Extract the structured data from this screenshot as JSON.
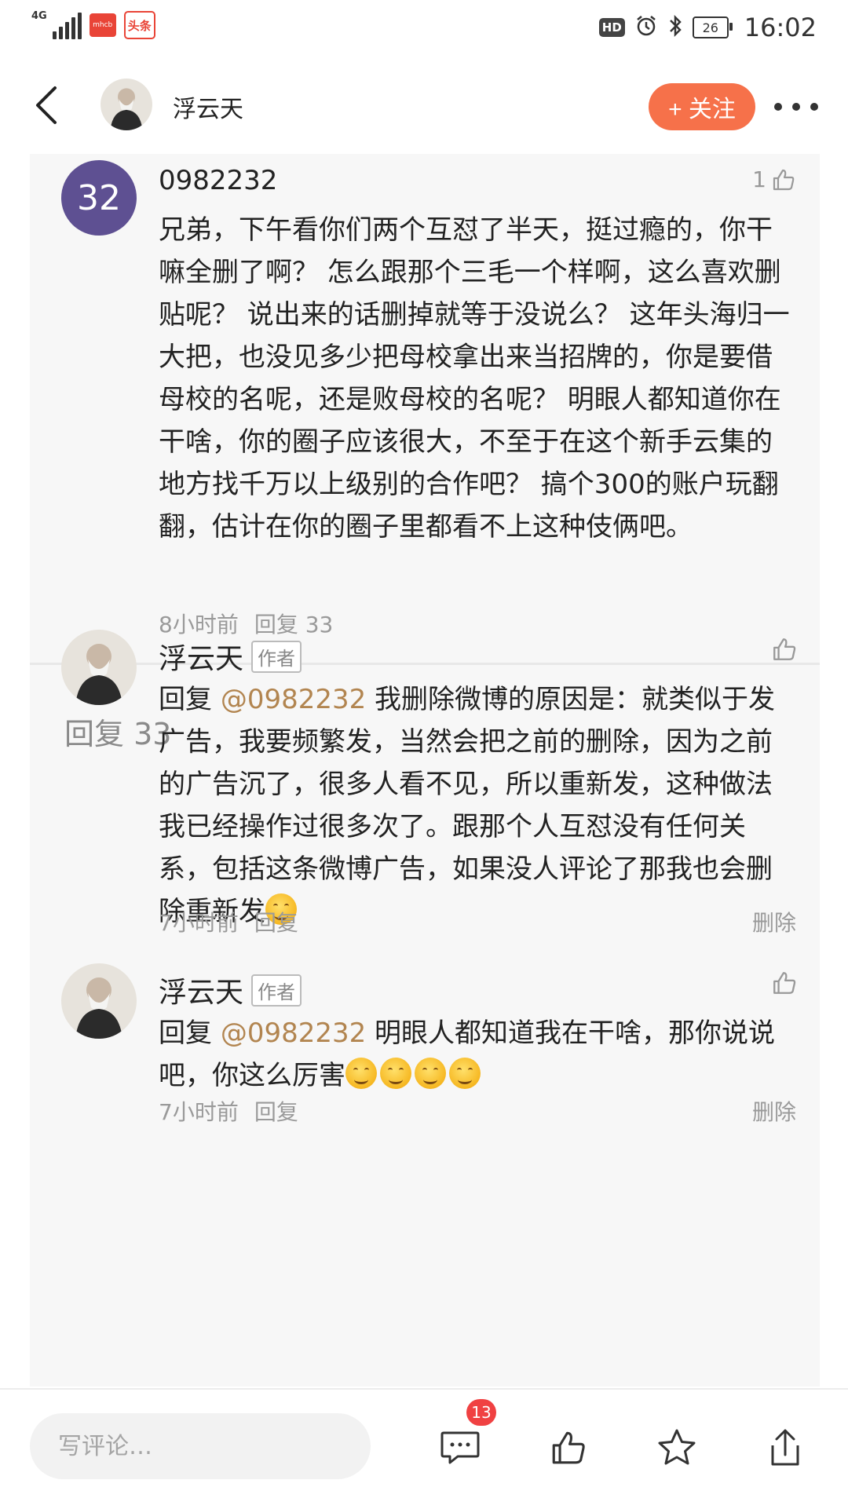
{
  "status_bar": {
    "network": "4G",
    "app_badge_1": "mhcb",
    "app_badge_2": "头条",
    "hd": "HD",
    "battery": "26",
    "time": "16:02"
  },
  "header": {
    "author_name": "浮云天",
    "follow_label": "+ 关注"
  },
  "main_comment": {
    "avatar_text": "32",
    "username": "0982232",
    "like_count": "1",
    "text": "兄弟，下午看你们两个互怼了半天，挺过瘾的，你干嘛全删了啊？ 怎么跟那个三毛一个样啊，这么喜欢删贴呢？ 说出来的话删掉就等于没说么？ 这年头海归一大把，也没见多少把母校拿出来当招牌的，你是要借母校的名呢，还是败母校的名呢？ 明眼人都知道你在干啥，你的圈子应该很大，不至于在这个新手云集的地方找千万以上级别的合作吧？ 搞个300的账户玩翻翻，估计在你的圈子里都看不上这种伎俩吧。",
    "time": "8小时前",
    "reply_label": "回复 33"
  },
  "replies_title": "回复 33",
  "replies": [
    {
      "name": "浮云天",
      "badge": "作者",
      "prefix": "回复 ",
      "mention": "@0982232",
      "text": " 我删除微博的原因是：就类似于发广告，我要频繁发，当然会把之前的删除，因为之前的广告沉了，很多人看不见，所以重新发，这种做法我已经操作过很多次了。跟那个人互怼没有任何关系，包括这条微博广告，如果没人评论了那我也会删除重新发",
      "time": "7小时前",
      "reply_label": "回复",
      "delete_label": "删除"
    },
    {
      "name": "浮云天",
      "badge": "作者",
      "prefix": "回复 ",
      "mention": "@0982232",
      "text": " 明眼人都知道我在干啥，那你说说吧，你这么厉害",
      "time": "7小时前",
      "reply_label": "回复",
      "delete_label": "删除"
    }
  ],
  "bottom_bar": {
    "input_placeholder": "写评论…",
    "comment_count": "13"
  },
  "colors": {
    "accent_orange": "#f6714a",
    "mention": "#b28550",
    "avatar_purple": "#5e5092",
    "badge_red": "#f04142"
  }
}
